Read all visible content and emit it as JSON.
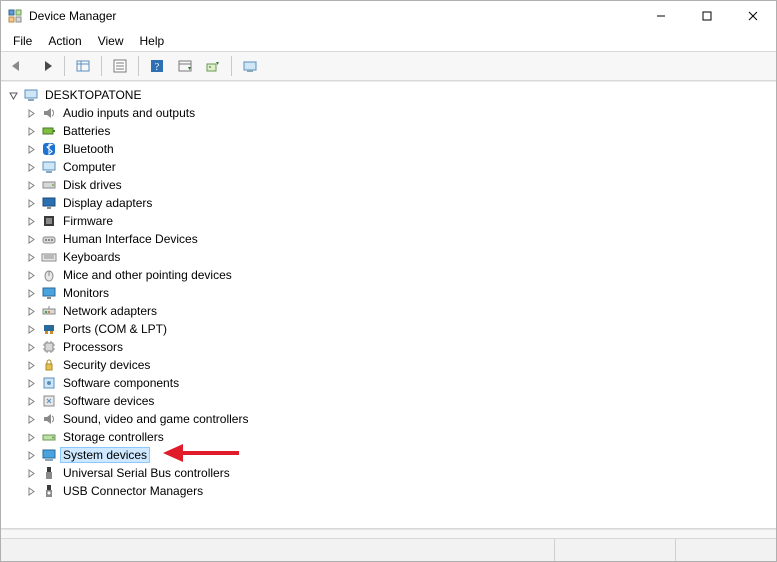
{
  "window": {
    "title": "Device Manager"
  },
  "menu": {
    "file": "File",
    "action": "Action",
    "view": "View",
    "help": "Help"
  },
  "tree": {
    "root": "DESKTOPATONE",
    "items": [
      {
        "label": "Audio inputs and outputs",
        "icon": "speaker"
      },
      {
        "label": "Batteries",
        "icon": "battery"
      },
      {
        "label": "Bluetooth",
        "icon": "bluetooth"
      },
      {
        "label": "Computer",
        "icon": "computer"
      },
      {
        "label": "Disk drives",
        "icon": "disk"
      },
      {
        "label": "Display adapters",
        "icon": "display"
      },
      {
        "label": "Firmware",
        "icon": "firmware"
      },
      {
        "label": "Human Interface Devices",
        "icon": "hid"
      },
      {
        "label": "Keyboards",
        "icon": "keyboard"
      },
      {
        "label": "Mice and other pointing devices",
        "icon": "mouse"
      },
      {
        "label": "Monitors",
        "icon": "monitor"
      },
      {
        "label": "Network adapters",
        "icon": "network"
      },
      {
        "label": "Ports (COM & LPT)",
        "icon": "port"
      },
      {
        "label": "Processors",
        "icon": "cpu"
      },
      {
        "label": "Security devices",
        "icon": "security"
      },
      {
        "label": "Software components",
        "icon": "softcomp"
      },
      {
        "label": "Software devices",
        "icon": "softdev"
      },
      {
        "label": "Sound, video and game controllers",
        "icon": "sound"
      },
      {
        "label": "Storage controllers",
        "icon": "storage"
      },
      {
        "label": "System devices",
        "icon": "system",
        "selected": true
      },
      {
        "label": "Universal Serial Bus controllers",
        "icon": "usb"
      },
      {
        "label": "USB Connector Managers",
        "icon": "usbconn"
      }
    ]
  },
  "annotation": {
    "arrow_color": "#e11b2a"
  }
}
